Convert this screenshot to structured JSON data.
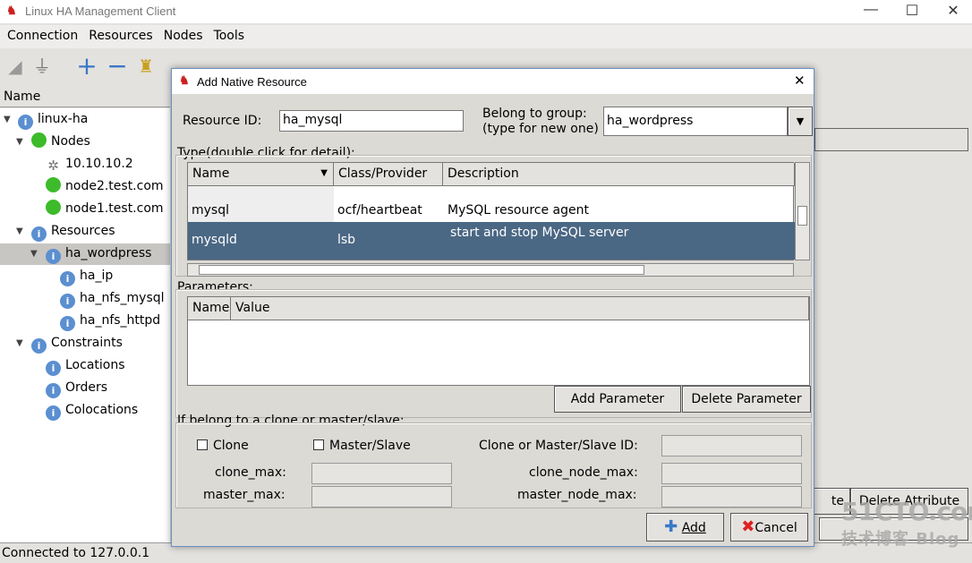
{
  "window": {
    "title": "Linux HA Management Client"
  },
  "menu": [
    "Connection",
    "Resources",
    "Nodes",
    "Tools"
  ],
  "tree": {
    "header": "Name",
    "items": [
      {
        "label": "linux-ha",
        "icon": "info-icon"
      },
      {
        "label": "Nodes",
        "icon": "green-dot-icon"
      },
      {
        "label": "10.10.10.2",
        "icon": "tools-icon"
      },
      {
        "label": "node2.test.com",
        "icon": "green-dot-icon"
      },
      {
        "label": "node1.test.com",
        "icon": "green-dot-icon"
      },
      {
        "label": "Resources",
        "icon": "info-icon"
      },
      {
        "label": "ha_wordpress",
        "icon": "info-icon"
      },
      {
        "label": "ha_ip",
        "icon": "info-icon"
      },
      {
        "label": "ha_nfs_mysql",
        "icon": "info-icon"
      },
      {
        "label": "ha_nfs_httpd",
        "icon": "info-icon"
      },
      {
        "label": "Constraints",
        "icon": "info-icon"
      },
      {
        "label": "Locations",
        "icon": "info-icon"
      },
      {
        "label": "Orders",
        "icon": "info-icon"
      },
      {
        "label": "Colocations",
        "icon": "info-icon"
      }
    ]
  },
  "background": {
    "btn_partial": "te",
    "btn_delete_attr": "Delete Attribute"
  },
  "status": "Connected to 127.0.0.1",
  "watermark": "51CTO.com 技术博客 Blog",
  "dialog": {
    "title": "Add Native Resource",
    "resource_id_label": "Resource ID:",
    "resource_id": "ha_mysql",
    "group_label1": "Belong to group:",
    "group_label2": "(type for new one)",
    "group": "ha_wordpress",
    "type_label": "Type(double click for detail):",
    "type_cols": [
      "Name",
      "Class/Provider",
      "Description"
    ],
    "type_rows": [
      {
        "name": "mysql",
        "class": "ocf/heartbeat",
        "desc": "MySQL resource agent"
      },
      {
        "name": "mysqld",
        "class": "lsb",
        "desc": "start and stop MySQL server",
        "selected": true
      }
    ],
    "params_label": "Parameters:",
    "param_cols": [
      "Name",
      "Value"
    ],
    "add_param": "Add Parameter",
    "delete_param": "Delete Parameter",
    "clone_label": "If belong to a clone or master/slave:",
    "clone": "Clone",
    "master_slave": "Master/Slave",
    "clone_id_label": "Clone or Master/Slave ID:",
    "clone_max": "clone_max:",
    "clone_node_max": "clone_node_max:",
    "master_max": "master_max:",
    "master_node_max": "master_node_max:",
    "add": "Add",
    "cancel": "Cancel"
  },
  "colors": {
    "selection": "#4a6784",
    "accent": "#5b8fd0"
  }
}
